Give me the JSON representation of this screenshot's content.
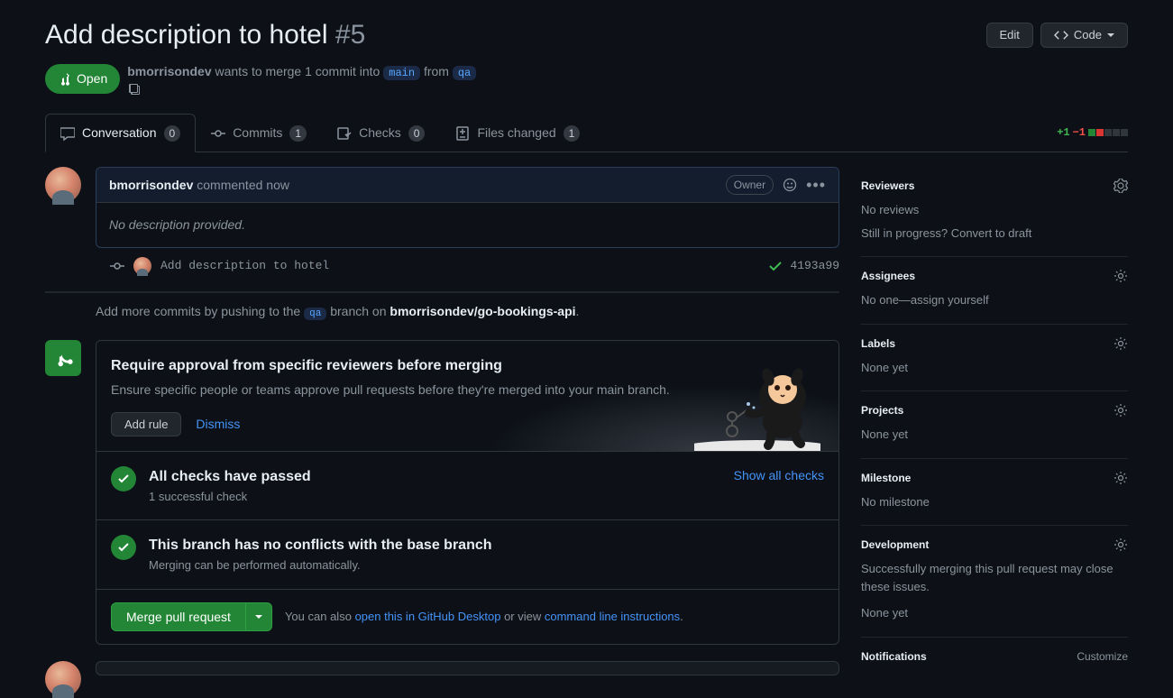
{
  "header": {
    "title": "Add description to hotel",
    "number": "#5",
    "edit": "Edit",
    "code": "Code"
  },
  "meta": {
    "state": "Open",
    "author": "bmorrisondev",
    "merge_text_1": "wants to merge 1 commit into",
    "base_branch": "main",
    "merge_text_2": "from",
    "head_branch": "qa"
  },
  "tabs": {
    "conversation": "Conversation",
    "conversation_count": "0",
    "commits": "Commits",
    "commits_count": "1",
    "checks": "Checks",
    "checks_count": "0",
    "files": "Files changed",
    "files_count": "1",
    "diff_add": "+1",
    "diff_del": "−1"
  },
  "comment": {
    "author": "bmorrisondev",
    "time": "commented now",
    "owner": "Owner",
    "body": "No description provided."
  },
  "commit": {
    "message": "Add description to hotel",
    "sha": "4193a99"
  },
  "hint": {
    "prefix": "Add more commits by pushing to the",
    "branch": "qa",
    "mid": "branch on",
    "repo": "bmorrisondev/go-bookings-api",
    "suffix": "."
  },
  "promo": {
    "title": "Require approval from specific reviewers before merging",
    "sub": "Ensure specific people or teams approve pull requests before they're merged into your main branch.",
    "add_rule": "Add rule",
    "dismiss": "Dismiss"
  },
  "checks_passed": {
    "title": "All checks have passed",
    "sub": "1 successful check",
    "show": "Show all checks"
  },
  "no_conflicts": {
    "title": "This branch has no conflicts with the base branch",
    "sub": "Merging can be performed automatically."
  },
  "merge": {
    "button": "Merge pull request",
    "hint_prefix": "You can also",
    "desktop_link": "open this in GitHub Desktop",
    "hint_mid": "or view",
    "cli_link": "command line instructions",
    "hint_suffix": "."
  },
  "sidebar": {
    "reviewers": {
      "title": "Reviewers",
      "text": "No reviews",
      "draft": "Still in progress? Convert to draft"
    },
    "assignees": {
      "title": "Assignees",
      "text": "No one—assign yourself"
    },
    "labels": {
      "title": "Labels",
      "text": "None yet"
    },
    "projects": {
      "title": "Projects",
      "text": "None yet"
    },
    "milestone": {
      "title": "Milestone",
      "text": "No milestone"
    },
    "development": {
      "title": "Development",
      "text": "Successfully merging this pull request may close these issues.",
      "none": "None yet"
    },
    "notifications": {
      "title": "Notifications",
      "customize": "Customize"
    }
  }
}
